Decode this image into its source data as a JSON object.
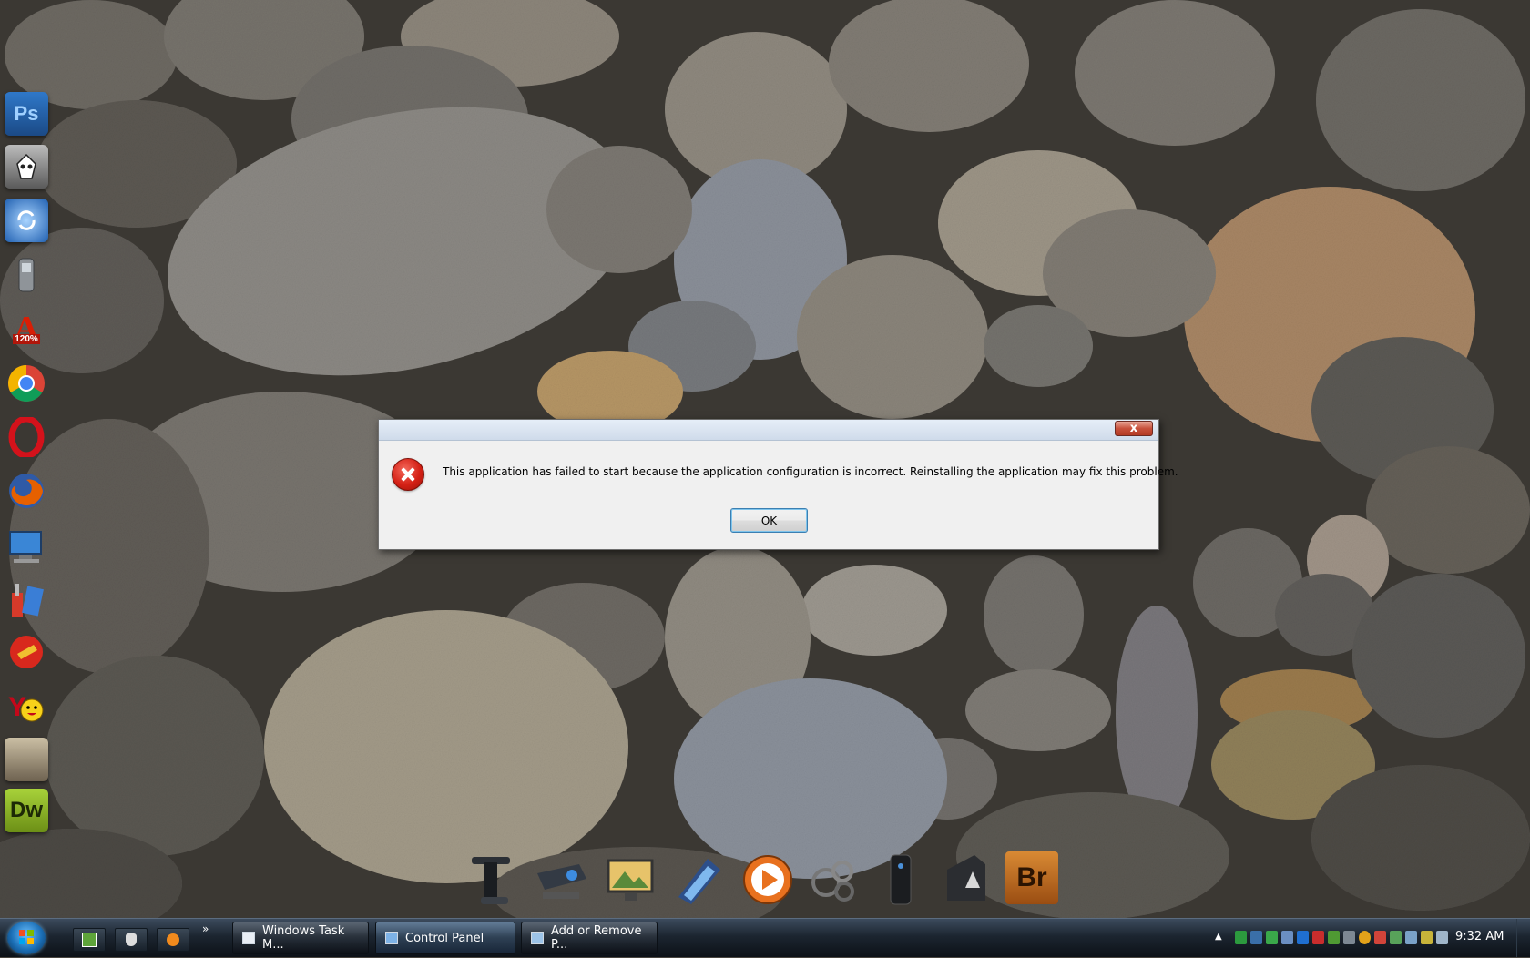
{
  "dialog": {
    "message": "This application has failed to start because the application configuration is incorrect. Reinstalling the application may fix this problem.",
    "ok_label": "OK",
    "close_glyph": "x",
    "icon": "error-icon"
  },
  "left_icons": [
    {
      "name": "photoshop-icon",
      "label": "Ps"
    },
    {
      "name": "foobar-icon",
      "label": ""
    },
    {
      "name": "sync-icon",
      "label": ""
    },
    {
      "name": "mobile-phone-icon",
      "label": ""
    },
    {
      "name": "acrobat-icon",
      "label": "120%"
    },
    {
      "name": "chrome-icon",
      "label": ""
    },
    {
      "name": "opera-icon",
      "label": ""
    },
    {
      "name": "firefox-icon",
      "label": ""
    },
    {
      "name": "my-computer-icon",
      "label": ""
    },
    {
      "name": "tools-icon",
      "label": ""
    },
    {
      "name": "cleaner-icon",
      "label": ""
    },
    {
      "name": "yahoo-messenger-icon",
      "label": ""
    },
    {
      "name": "game-icon",
      "label": ""
    },
    {
      "name": "dreamweaver-icon",
      "label": "Dw"
    }
  ],
  "dock": [
    {
      "name": "t-shaped-device-icon",
      "label": ""
    },
    {
      "name": "projector-icon",
      "label": ""
    },
    {
      "name": "monitor-art-icon",
      "label": ""
    },
    {
      "name": "tablet-pen-icon",
      "label": ""
    },
    {
      "name": "media-player-icon",
      "label": ""
    },
    {
      "name": "bubbles-icon",
      "label": ""
    },
    {
      "name": "speaker-tower-icon",
      "label": ""
    },
    {
      "name": "alienware-icon",
      "label": ""
    },
    {
      "name": "bridge-icon",
      "label": "Br"
    }
  ],
  "taskbar": {
    "quick_launch": [
      "utorrent-icon",
      "foobar-icon",
      "vlc-icon"
    ],
    "more_glyph": "»",
    "tasks": [
      {
        "name": "task-windows-task-manager",
        "label": "Windows Task M..."
      },
      {
        "name": "task-control-panel",
        "label": "Control Panel"
      },
      {
        "name": "task-add-remove-programs",
        "label": "Add or Remove P..."
      }
    ],
    "tray_arrow": "▲",
    "clock": "9:32 AM"
  },
  "colors": {
    "dialog_bg": "#f0f0f0",
    "error_red": "#d42015",
    "taskbar": "#1c2530",
    "ps_blue": "#2c7fd1",
    "dw_green": "#8fb82b",
    "br_orange": "#c86a1d"
  }
}
